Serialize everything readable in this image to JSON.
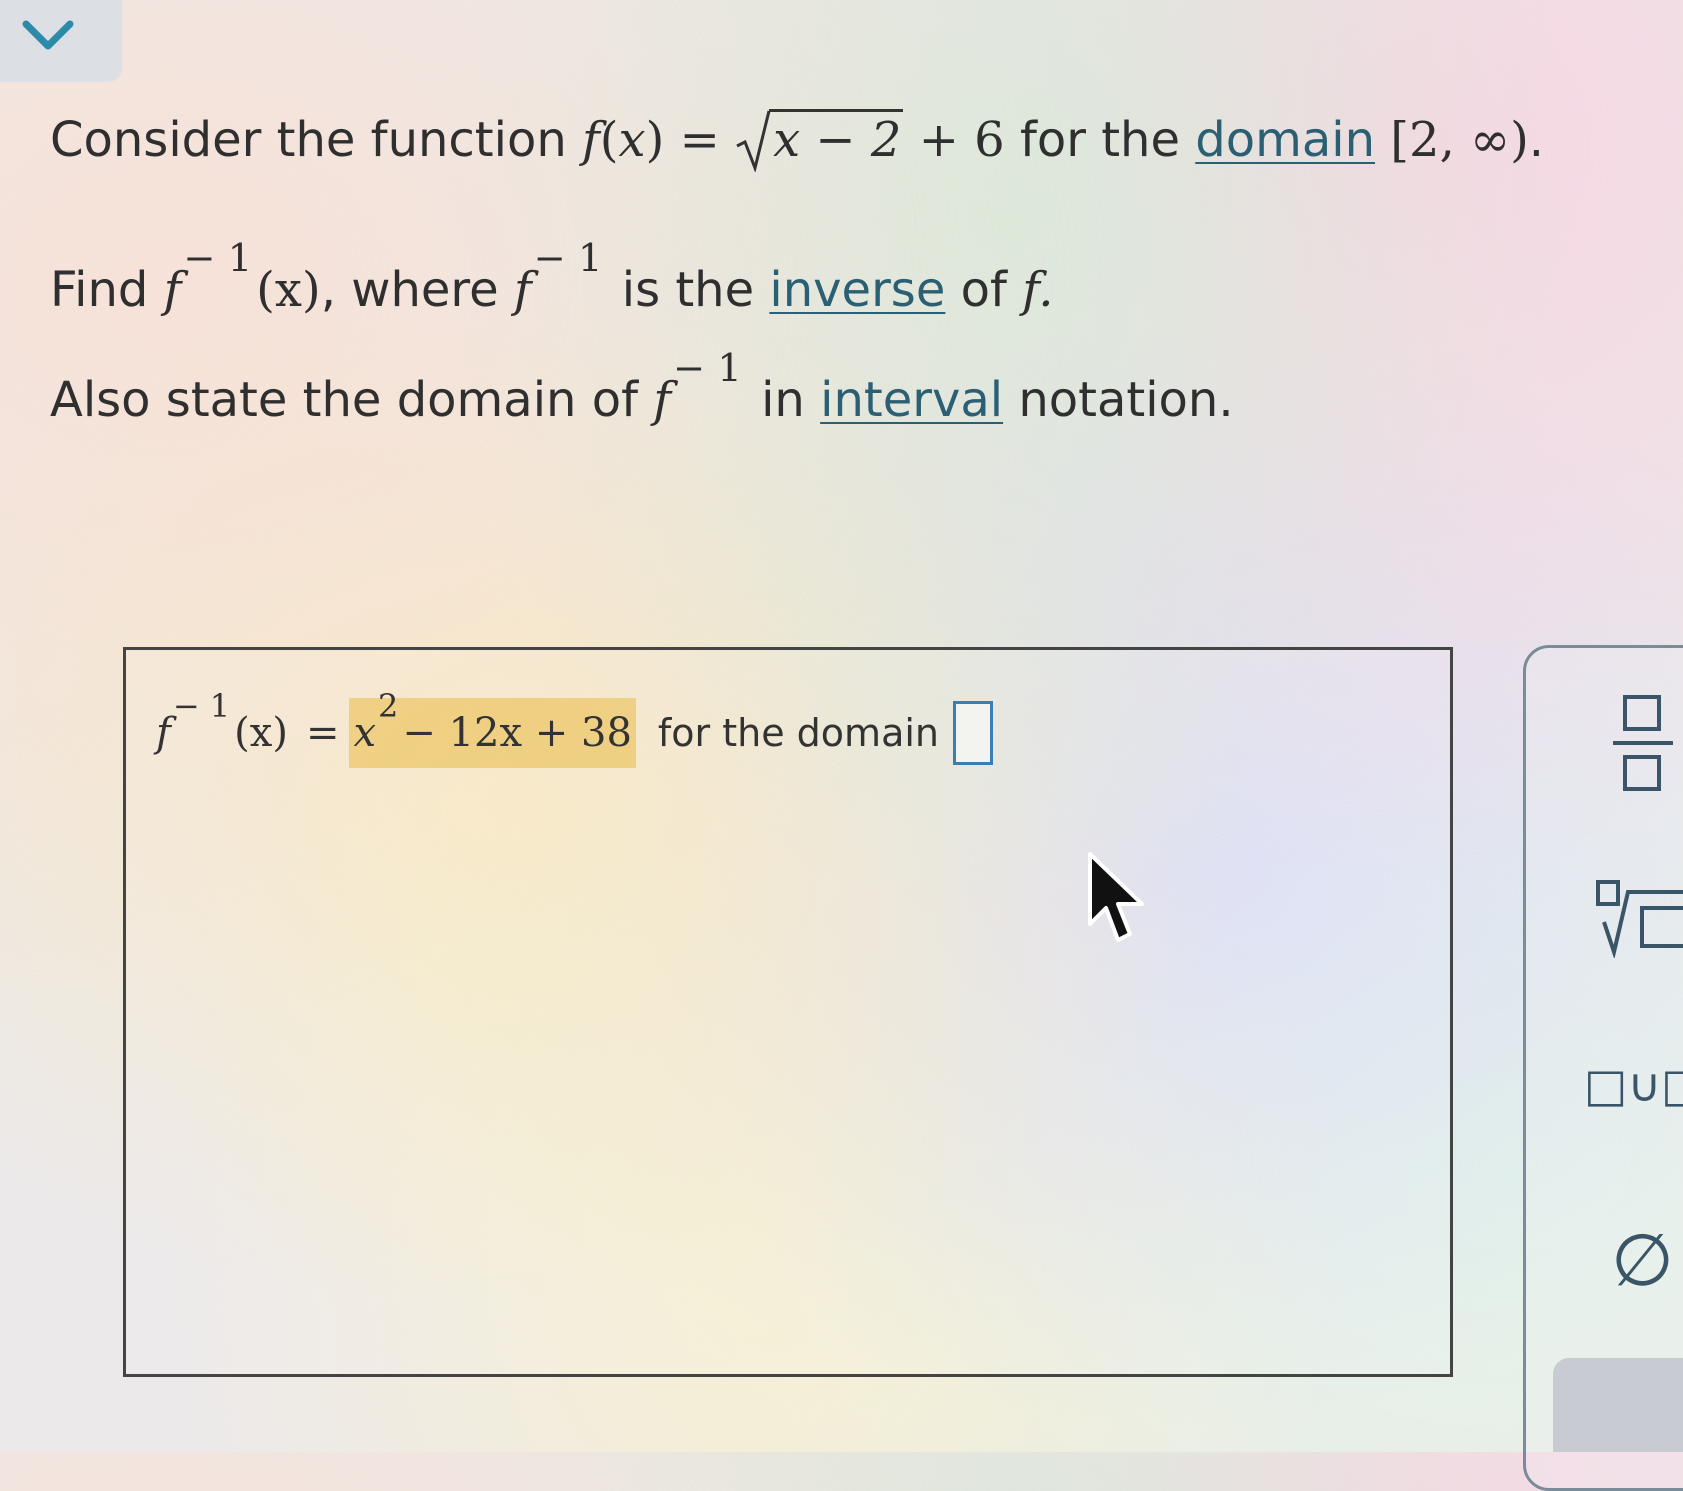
{
  "question": {
    "line1": {
      "prefix": "Consider the function",
      "func": "f",
      "var": "x",
      "open_paren": "(",
      "close_paren": ")",
      "equals": "=",
      "radicand": "x − 2",
      "plus_six": "+ 6",
      "middle": "for the",
      "domain_link": "domain",
      "interval": "[2, ∞)",
      "end": "."
    },
    "line2": {
      "prefix": "Find",
      "func": "f",
      "exp": "− 1",
      "arg": "(x)",
      "where": ", where",
      "is_the": "is the",
      "inverse_link": "inverse",
      "of": "of",
      "end_func": "f."
    },
    "line3": {
      "prefix": "Also state the domain of",
      "func": "f",
      "exp": "− 1",
      "in": "in",
      "interval_link": "interval",
      "notation": "notation."
    }
  },
  "answer": {
    "func": "f",
    "exp": "− 1",
    "arg": "(x)",
    "equals": "=",
    "x": "x",
    "x_exp": "2",
    "rest": "− 12x + 38",
    "for_domain": "for the domain",
    "domain_input_value": ""
  },
  "palette": {
    "union": "□∪□",
    "empty_set": "∅"
  },
  "icons": {
    "collapse": "chevron-down-icon",
    "cursor": "mouse-pointer-icon"
  },
  "colors": {
    "accent_teal": "#2b8aa8",
    "highlight": "#ebc35a",
    "input_border": "#3b7db5"
  }
}
